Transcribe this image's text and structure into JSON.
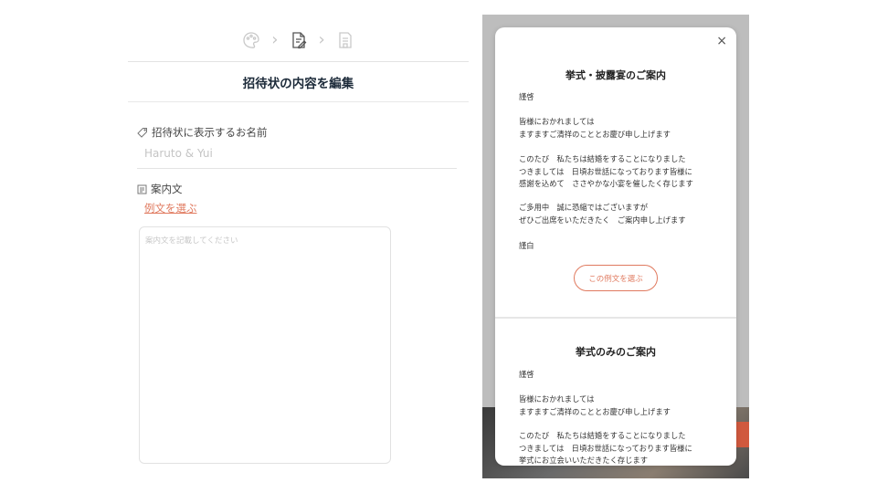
{
  "editor": {
    "title": "招待状の内容を編集",
    "name_label": "招待状に表示するお名前",
    "name_value": "Haruto & Yui",
    "message_label": "案内文",
    "choose_example_link": "例文を選ぶ",
    "message_placeholder": "案内文を記載してください"
  },
  "modal": {
    "close": "×",
    "sections": [
      {
        "title": "挙式・披露宴のご案内",
        "greeting": "謹啓",
        "para1": [
          "皆様におかれましては",
          "ますますご清祥のこととお慶び申し上げます"
        ],
        "para2": [
          "このたび　私たちは結婚をすることになりました",
          "つきましては　日頃お世話になっております皆様に",
          "感謝を込めて　ささやかな小宴を催したく存じます"
        ],
        "para3": [
          "ご多用中　誠に恐縮ではございますが",
          "ぜひご出席をいただきたく　ご案内申し上げます"
        ],
        "closing": "謹白",
        "button": "この例文を選ぶ"
      },
      {
        "title": "挙式のみのご案内",
        "greeting": "謹啓",
        "para1": [
          "皆様におかれましては",
          "ますますご清祥のこととお慶び申し上げます"
        ],
        "para2": [
          "このたび　私たちは結婚をすることになりました",
          "つきましては　日頃お世話になっております皆様に",
          "挙式にお立会いいただきたく存じます"
        ]
      }
    ]
  },
  "colors": {
    "accent": "#e07a5f",
    "title": "#1d2b3a"
  }
}
